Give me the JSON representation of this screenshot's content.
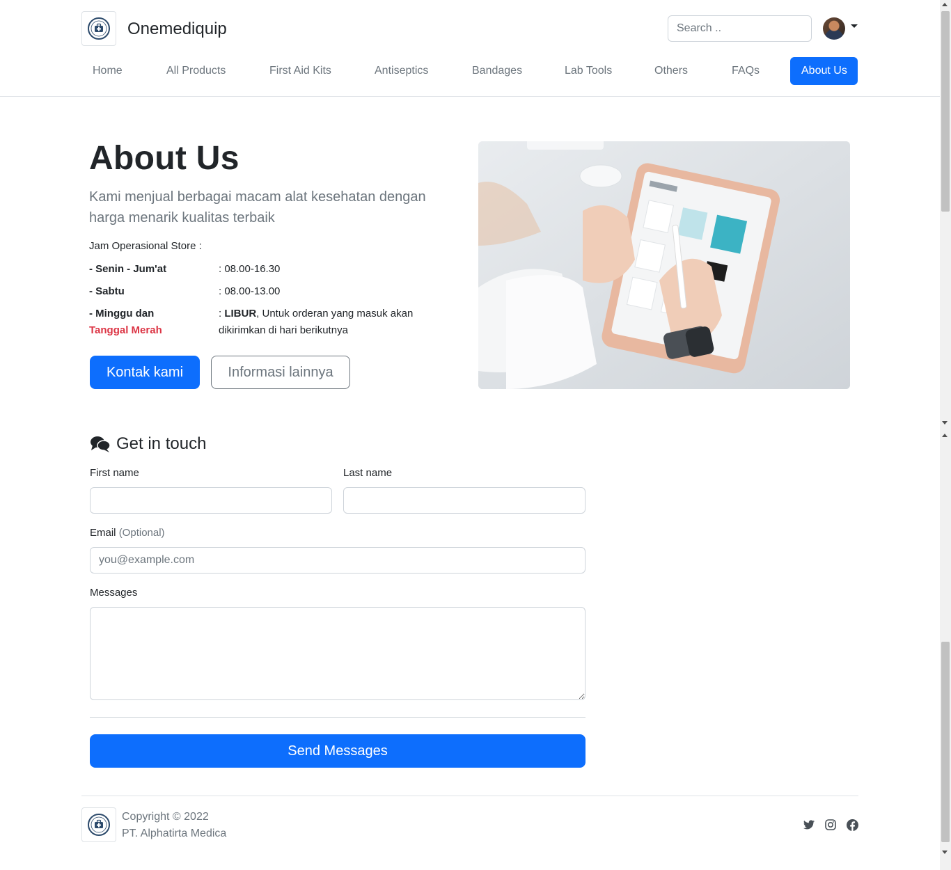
{
  "brand": {
    "name": "Onemediquip"
  },
  "search": {
    "placeholder": "Search .."
  },
  "nav": {
    "items": [
      {
        "label": "Home"
      },
      {
        "label": "All Products"
      },
      {
        "label": "First Aid Kits"
      },
      {
        "label": "Antiseptics"
      },
      {
        "label": "Bandages"
      },
      {
        "label": "Lab Tools"
      },
      {
        "label": "Others"
      },
      {
        "label": "FAQs"
      },
      {
        "label": "About Us"
      }
    ],
    "active": "About Us"
  },
  "hero": {
    "title": "About Us",
    "lead": "Kami menjual berbagai macam alat kesehatan dengan harga menarik kualitas terbaik",
    "hours_title": "Jam Operasional Store :",
    "hours": [
      {
        "label": "- Senin - Jum'at",
        "value": ": 08.00-16.30"
      },
      {
        "label": "- Sabtu",
        "value": ": 08.00-13.00"
      },
      {
        "label": "- Minggu dan",
        "label_red": "Tanggal Merah",
        "value_prefix": ": ",
        "value_bold": "LIBUR",
        "value_rest": ", Untuk orderan yang masuk akan dikirimkan di hari berikutnya"
      }
    ],
    "primary_button": "Kontak kami",
    "secondary_button": "Informasi lainnya"
  },
  "contact": {
    "title": "Get in touch",
    "first_name_label": "First name",
    "last_name_label": "Last name",
    "email_label": "Email",
    "email_optional": "(Optional)",
    "email_placeholder": "you@example.com",
    "messages_label": "Messages",
    "submit": "Send Messages"
  },
  "footer": {
    "copyright": "Copyright © 2022",
    "company": "PT. Alphatirta Medica",
    "social": [
      "twitter-icon",
      "instagram-icon",
      "facebook-icon"
    ]
  },
  "colors": {
    "primary": "#0d6efd",
    "muted": "#6c757d",
    "danger": "#dc3545"
  }
}
